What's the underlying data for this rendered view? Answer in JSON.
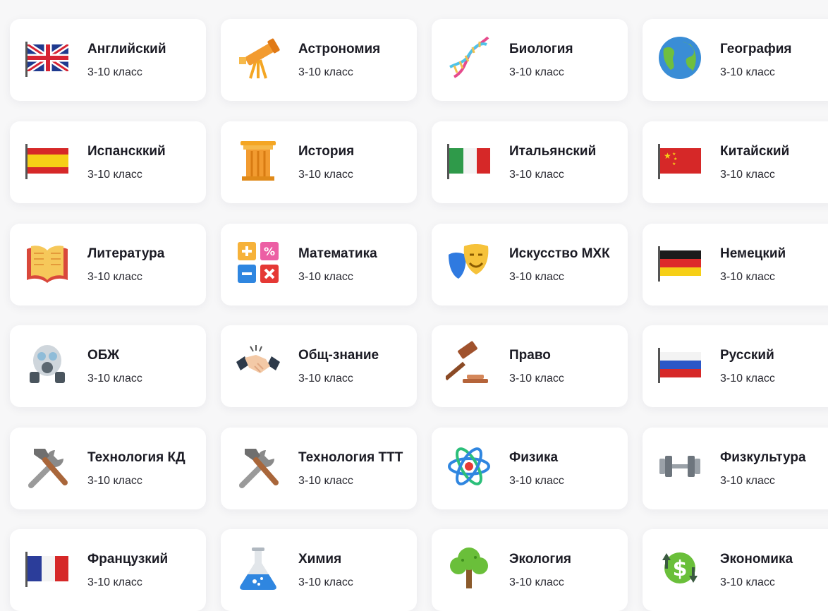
{
  "subjects": [
    {
      "title": "Английский",
      "grade": "3-10 класс",
      "icon": "uk-flag-icon"
    },
    {
      "title": "Астрономия",
      "grade": "3-10 класс",
      "icon": "telescope-icon"
    },
    {
      "title": "Биология",
      "grade": "3-10 класс",
      "icon": "dna-icon"
    },
    {
      "title": "География",
      "grade": "3-10 класс",
      "icon": "globe-icon"
    },
    {
      "title": "Испансккий",
      "grade": "3-10 класс",
      "icon": "spain-flag-icon"
    },
    {
      "title": "История",
      "grade": "3-10 класс",
      "icon": "column-icon"
    },
    {
      "title": "Итальянский",
      "grade": "3-10 класс",
      "icon": "italy-flag-icon"
    },
    {
      "title": "Китайский",
      "grade": "3-10 класс",
      "icon": "china-flag-icon"
    },
    {
      "title": "Литература",
      "grade": "3-10 класс",
      "icon": "open-book-icon"
    },
    {
      "title": "Математика",
      "grade": "3-10 класс",
      "icon": "math-operators-icon"
    },
    {
      "title": "Искусство МХК",
      "grade": "3-10 класс",
      "icon": "theater-masks-icon"
    },
    {
      "title": "Немецкий",
      "grade": "3-10 класс",
      "icon": "germany-flag-icon"
    },
    {
      "title": "ОБЖ",
      "grade": "3-10 класс",
      "icon": "gas-mask-icon"
    },
    {
      "title": "Общ-знание",
      "grade": "3-10 класс",
      "icon": "handshake-icon"
    },
    {
      "title": "Право",
      "grade": "3-10 класс",
      "icon": "gavel-icon"
    },
    {
      "title": "Русский",
      "grade": "3-10 класс",
      "icon": "russia-flag-icon"
    },
    {
      "title": "Технология КД",
      "grade": "3-10 класс",
      "icon": "tools-icon"
    },
    {
      "title": "Технология ТТТ",
      "grade": "3-10 класс",
      "icon": "tools-icon"
    },
    {
      "title": "Физика",
      "grade": "3-10 класс",
      "icon": "atom-icon"
    },
    {
      "title": "Физкультура",
      "grade": "3-10 класс",
      "icon": "dumbbell-icon"
    },
    {
      "title": "Французкий",
      "grade": "3-10 класс",
      "icon": "france-flag-icon"
    },
    {
      "title": "Химия",
      "grade": "3-10 класс",
      "icon": "flask-icon"
    },
    {
      "title": "Экология",
      "grade": "3-10 класс",
      "icon": "tree-icon"
    },
    {
      "title": "Экономика",
      "grade": "3-10 класс",
      "icon": "dollar-exchange-icon"
    }
  ]
}
